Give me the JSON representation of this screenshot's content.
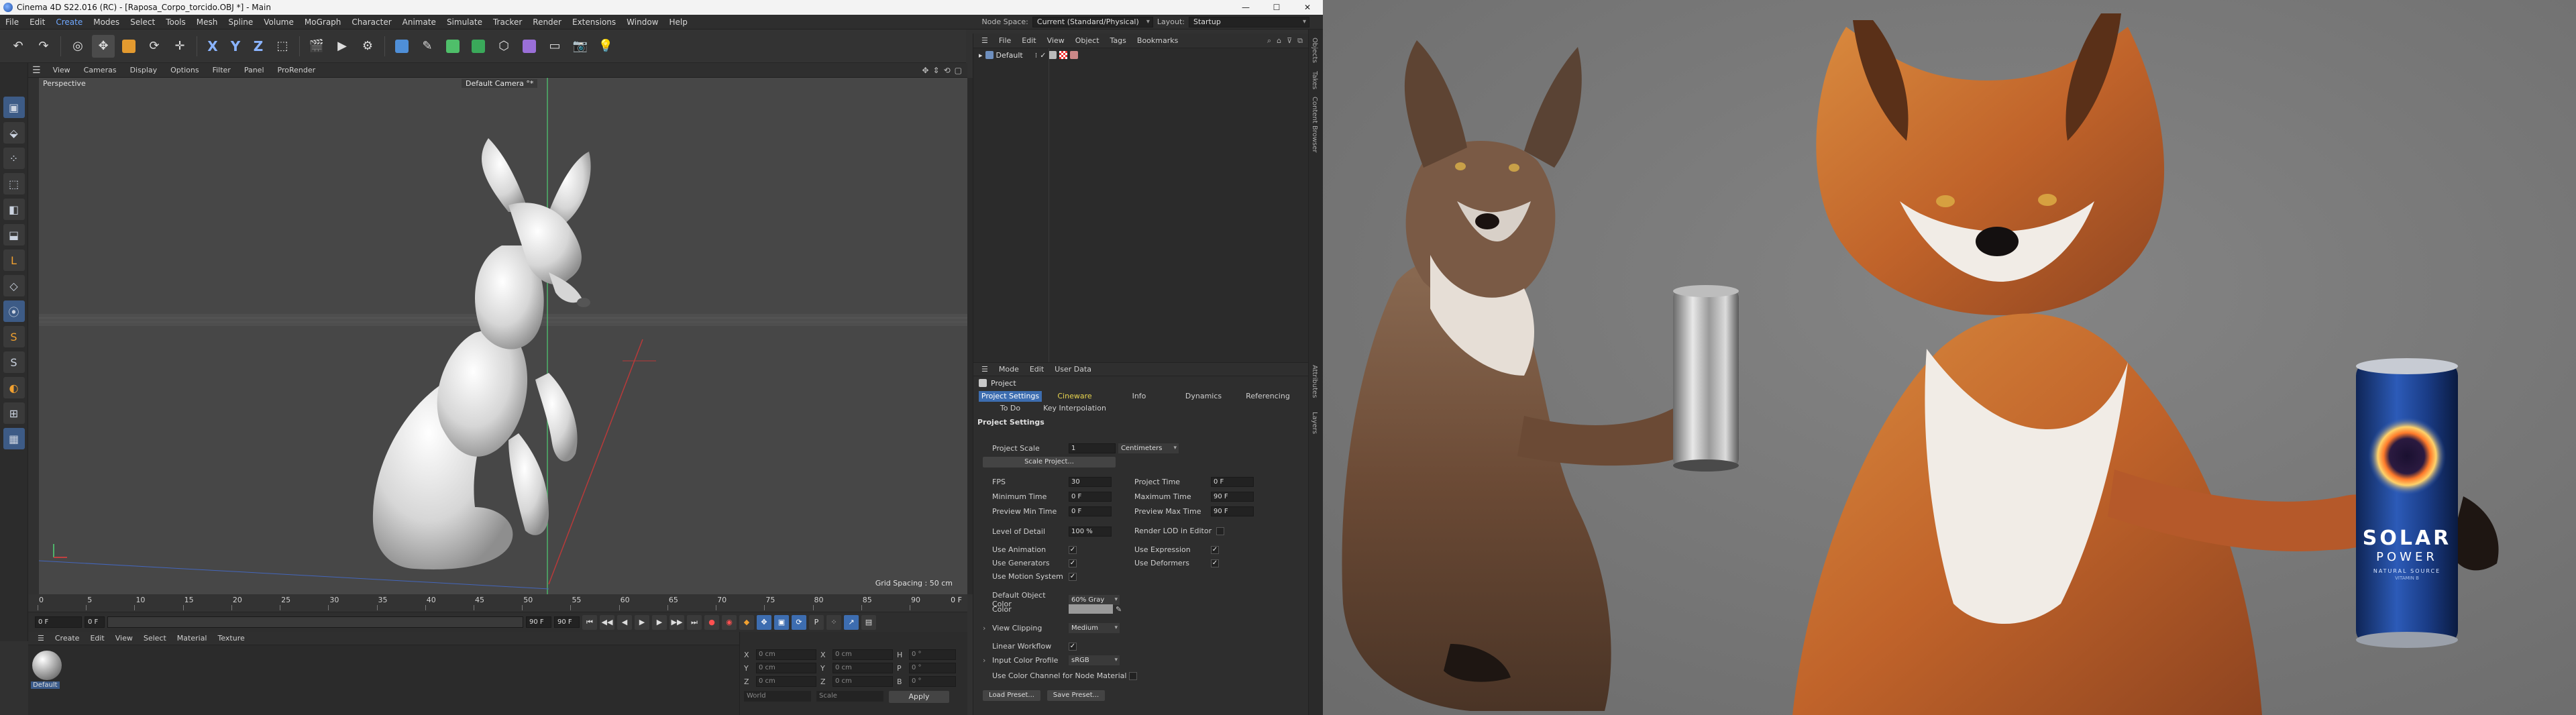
{
  "window": {
    "title": "Cinema 4D S22.016 (RC) - [Raposa_Corpo_torcido.OBJ *] - Main",
    "min": "—",
    "max": "☐",
    "close": "✕"
  },
  "menubar": {
    "items": [
      "File",
      "Edit",
      "Create",
      "Modes",
      "Select",
      "Tools",
      "Mesh",
      "Spline",
      "Volume",
      "MoGraph",
      "Character",
      "Animate",
      "Simulate",
      "Tracker",
      "Render",
      "Extensions",
      "Window",
      "Help"
    ],
    "node_space_label": "Node Space:",
    "node_space_value": "Current (Standard/Physical)",
    "layout_label": "Layout:",
    "layout_value": "Startup"
  },
  "viewport": {
    "menu": [
      "View",
      "Cameras",
      "Display",
      "Options",
      "Filter",
      "Panel",
      "ProRender"
    ],
    "label": "Perspective",
    "camera": "Default Camera °*",
    "grid_spacing": "Grid Spacing : 50 cm"
  },
  "timeline": {
    "ticks": [
      "0",
      "5",
      "10",
      "15",
      "20",
      "25",
      "30",
      "35",
      "40",
      "45",
      "50",
      "55",
      "60",
      "65",
      "70",
      "75",
      "80",
      "85",
      "90"
    ],
    "end_frame": "0 F",
    "start_field": "0 F",
    "current_field": "0 F",
    "end_field": "90 F",
    "end_field2": "90 F"
  },
  "material_manager": {
    "menu": [
      "Create",
      "Edit",
      "View",
      "Select",
      "Material",
      "Texture"
    ],
    "material_name": "Default"
  },
  "coordinates": {
    "rows": [
      {
        "a": "X",
        "v1": "0 cm",
        "b": "X",
        "v2": "0 cm",
        "c": "H",
        "v3": "0 °"
      },
      {
        "a": "Y",
        "v1": "0 cm",
        "b": "Y",
        "v2": "0 cm",
        "c": "P",
        "v3": "0 °"
      },
      {
        "a": "Z",
        "v1": "0 cm",
        "b": "Z",
        "v2": "0 cm",
        "c": "B",
        "v3": "0 °"
      }
    ],
    "space": "World",
    "mode": "Scale",
    "apply": "Apply"
  },
  "object_manager": {
    "menu": [
      "File",
      "Edit",
      "View",
      "Object",
      "Tags",
      "Bookmarks"
    ],
    "object": "Default"
  },
  "side_tabs": [
    "Objects",
    "Takes",
    "Content Browser",
    "Attributes",
    "Layers"
  ],
  "attributes": {
    "menu": [
      "Mode",
      "Edit",
      "User Data"
    ],
    "header": "Project",
    "tabs": [
      {
        "label": "Project Settings",
        "active": true
      },
      {
        "label": "Cineware",
        "active": false
      },
      {
        "label": "Info",
        "active": false
      },
      {
        "label": "Dynamics",
        "active": false
      },
      {
        "label": "Referencing",
        "active": false
      },
      {
        "label": "To Do",
        "active": false
      },
      {
        "label": "Key Interpolation",
        "active": false
      }
    ],
    "section": "Project Settings",
    "project_scale_label": "Project Scale",
    "project_scale_value": "1",
    "project_scale_unit": "Centimeters",
    "scale_project_btn": "Scale Project...",
    "fps_label": "FPS",
    "fps_value": "30",
    "project_time_label": "Project Time",
    "project_time_value": "0 F",
    "min_time_label": "Minimum Time",
    "min_time_value": "0 F",
    "max_time_label": "Maximum Time",
    "max_time_value": "90 F",
    "preview_min_label": "Preview Min Time",
    "preview_min_value": "0 F",
    "preview_max_label": "Preview Max Time",
    "preview_max_value": "90 F",
    "lod_label": "Level of Detail",
    "lod_value": "100 %",
    "render_lod_label": "Render LOD in Editor",
    "use_animation_label": "Use Animation",
    "use_expression_label": "Use Expression",
    "use_generators_label": "Use Generators",
    "use_deformers_label": "Use Deformers",
    "use_motion_label": "Use Motion System",
    "default_color_label": "Default Object Color",
    "default_color_value": "60% Gray",
    "color_label": "Color",
    "view_clipping_label": "View Clipping",
    "view_clipping_value": "Medium",
    "linear_workflow_label": "Linear Workflow",
    "input_color_label": "Input Color Profile",
    "input_color_value": "sRGB",
    "use_color_channel_label": "Use Color Channel for Node Material",
    "load_preset": "Load Preset...",
    "save_preset": "Save Preset...",
    "check": "✓"
  },
  "render": {
    "can_brand": "SOLAR",
    "can_sub": "POWER",
    "can_small": "NATURAL SOURCE",
    "can_tiny": "VITAMIN B"
  },
  "colors": {
    "viewport_bg": "#474747",
    "render_bg": "#7a7a7a",
    "accent": "#3d6db0",
    "fox_orange": "#c9692a"
  }
}
